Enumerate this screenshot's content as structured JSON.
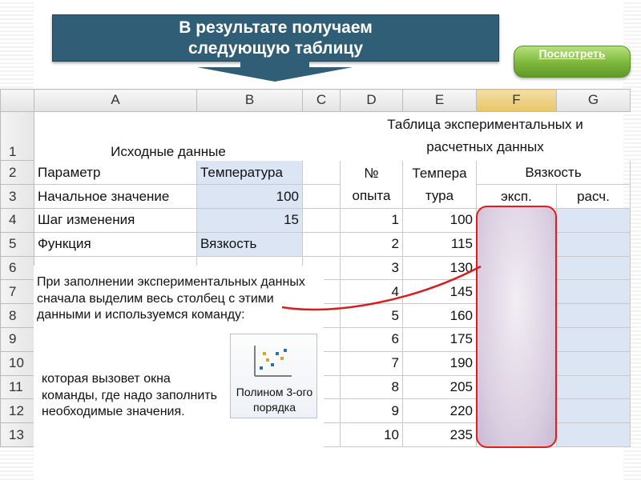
{
  "slide": {
    "title": "В результате получаем следующую таблицу",
    "view_button": "Посмотреть"
  },
  "sheet": {
    "columns": [
      "A",
      "B",
      "C",
      "D",
      "E",
      "F",
      "G"
    ],
    "rows": [
      "1",
      "2",
      "3",
      "4",
      "5",
      "6",
      "7",
      "8",
      "9",
      "10",
      "11",
      "12",
      "13"
    ],
    "source_title": "Исходные данные",
    "exp_title_line1": "Таблица экспериментальных и",
    "exp_title_line2": "расчетных данных",
    "params": [
      {
        "name": "Параметр",
        "value": "Температура"
      },
      {
        "name": "Начальное значение",
        "value": "100"
      },
      {
        "name": "Шаг изменения",
        "value": "15"
      },
      {
        "name": "Функция",
        "value": "Вязкость"
      }
    ],
    "exp_headers": {
      "num_line1": "№",
      "num_line2": "опыта",
      "temp_line1": "Темпера",
      "temp_line2": "тура",
      "visc": "Вязкость",
      "exp": "эксп.",
      "calc": "расч."
    },
    "exp_rows": [
      {
        "n": "1",
        "t": "100"
      },
      {
        "n": "2",
        "t": "115"
      },
      {
        "n": "3",
        "t": "130"
      },
      {
        "n": "4",
        "t": "145"
      },
      {
        "n": "5",
        "t": "160"
      },
      {
        "n": "6",
        "t": "175"
      },
      {
        "n": "7",
        "t": "190"
      },
      {
        "n": "8",
        "t": "205"
      },
      {
        "n": "9",
        "t": "220"
      },
      {
        "n": "10",
        "t": "235"
      }
    ]
  },
  "notes": {
    "first": "При заполнении экспериментальных данных сначала выделим весь столбец с этими данными и используемся команду:",
    "second": "которая вызовет окна команды, где надо заполнить необходимые значения.",
    "ribbon_command": "Полином 3-ого порядка"
  },
  "colors": {
    "banner": "#305e76",
    "button": "#7cb63c",
    "cell_blue": "#dbe5f4",
    "highlight_border": "#e01e1e"
  }
}
